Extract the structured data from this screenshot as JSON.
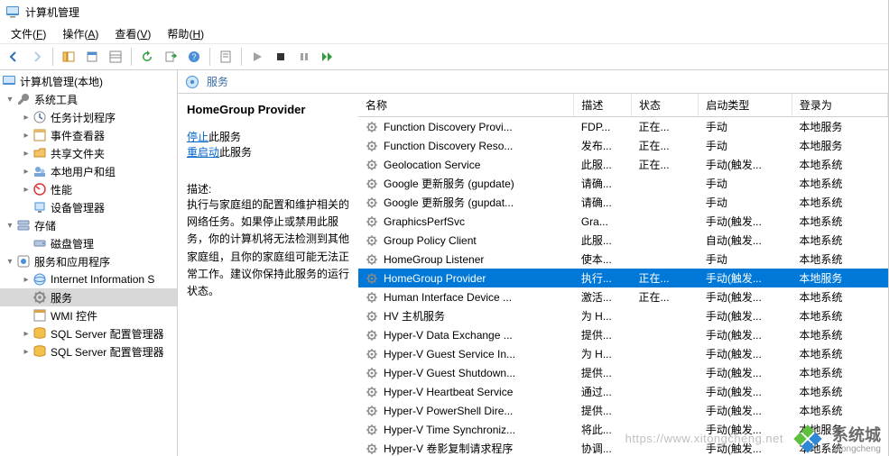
{
  "window": {
    "title": "计算机管理"
  },
  "menubar": [
    {
      "label": "文件",
      "hotkey": "F"
    },
    {
      "label": "操作",
      "hotkey": "A"
    },
    {
      "label": "查看",
      "hotkey": "V"
    },
    {
      "label": "帮助",
      "hotkey": "H"
    }
  ],
  "toolbar": {
    "back": "back-icon",
    "forward": "forward-icon",
    "up": "up-icon",
    "props": "properties-icon",
    "explorer": "explorer-icon",
    "refresh": "refresh-icon",
    "export": "export-icon",
    "help": "help-icon",
    "sheet": "sheet-icon",
    "play": "play-icon",
    "stop": "stop-icon",
    "pause": "pause-icon",
    "restart": "restart-icon"
  },
  "tree": {
    "root": {
      "label": "计算机管理(本地)"
    },
    "system_tools": {
      "label": "系统工具",
      "children": [
        {
          "id": "task-scheduler",
          "label": "任务计划程序"
        },
        {
          "id": "event-viewer",
          "label": "事件查看器"
        },
        {
          "id": "shared-folders",
          "label": "共享文件夹"
        },
        {
          "id": "local-users",
          "label": "本地用户和组"
        },
        {
          "id": "performance",
          "label": "性能"
        },
        {
          "id": "device-manager",
          "label": "设备管理器"
        }
      ]
    },
    "storage": {
      "label": "存储",
      "children": [
        {
          "id": "disk-mgmt",
          "label": "磁盘管理"
        }
      ]
    },
    "services_apps": {
      "label": "服务和应用程序",
      "children": [
        {
          "id": "iis",
          "label": "Internet Information S"
        },
        {
          "id": "services",
          "label": "服务",
          "selected": true
        },
        {
          "id": "wmi",
          "label": "WMI 控件"
        },
        {
          "id": "sqlcfg1",
          "label": "SQL Server 配置管理器"
        },
        {
          "id": "sqlcfg2",
          "label": "SQL Server 配置管理器"
        }
      ]
    }
  },
  "content": {
    "header_label": "服务",
    "selected_name": "HomeGroup Provider",
    "actions": {
      "stop_link": "停止",
      "stop_suffix": "此服务",
      "restart_link": "重启动",
      "restart_suffix": "此服务"
    },
    "desc_label": "描述:",
    "desc_text": "执行与家庭组的配置和维护相关的网络任务。如果停止或禁用此服务，你的计算机将无法检测到其他家庭组，且你的家庭组可能无法正常工作。建议你保持此服务的运行状态。"
  },
  "columns": {
    "name": "名称",
    "desc": "描述",
    "status": "状态",
    "startup": "启动类型",
    "logon": "登录为"
  },
  "services": [
    {
      "name": "Function Discovery Provi...",
      "desc": "FDP...",
      "status": "正在...",
      "startup": "手动",
      "logon": "本地服务"
    },
    {
      "name": "Function Discovery Reso...",
      "desc": "发布...",
      "status": "正在...",
      "startup": "手动",
      "logon": "本地服务"
    },
    {
      "name": "Geolocation Service",
      "desc": "此服...",
      "status": "正在...",
      "startup": "手动(触发...",
      "logon": "本地系统"
    },
    {
      "name": "Google 更新服务 (gupdate)",
      "desc": "请确...",
      "status": "",
      "startup": "手动",
      "logon": "本地系统"
    },
    {
      "name": "Google 更新服务 (gupdat...",
      "desc": "请确...",
      "status": "",
      "startup": "手动",
      "logon": "本地系统"
    },
    {
      "name": "GraphicsPerfSvc",
      "desc": "Gra...",
      "status": "",
      "startup": "手动(触发...",
      "logon": "本地系统"
    },
    {
      "name": "Group Policy Client",
      "desc": "此服...",
      "status": "",
      "startup": "自动(触发...",
      "logon": "本地系统"
    },
    {
      "name": "HomeGroup Listener",
      "desc": "使本...",
      "status": "",
      "startup": "手动",
      "logon": "本地系统"
    },
    {
      "name": "HomeGroup Provider",
      "desc": "执行...",
      "status": "正在...",
      "startup": "手动(触发...",
      "logon": "本地服务",
      "selected": true
    },
    {
      "name": "Human Interface Device ...",
      "desc": "激活...",
      "status": "正在...",
      "startup": "手动(触发...",
      "logon": "本地系统"
    },
    {
      "name": "HV 主机服务",
      "desc": "为 H...",
      "status": "",
      "startup": "手动(触发...",
      "logon": "本地系统"
    },
    {
      "name": "Hyper-V Data Exchange ...",
      "desc": "提供...",
      "status": "",
      "startup": "手动(触发...",
      "logon": "本地系统"
    },
    {
      "name": "Hyper-V Guest Service In...",
      "desc": "为 H...",
      "status": "",
      "startup": "手动(触发...",
      "logon": "本地系统"
    },
    {
      "name": "Hyper-V Guest Shutdown...",
      "desc": "提供...",
      "status": "",
      "startup": "手动(触发...",
      "logon": "本地系统"
    },
    {
      "name": "Hyper-V Heartbeat Service",
      "desc": "通过...",
      "status": "",
      "startup": "手动(触发...",
      "logon": "本地系统"
    },
    {
      "name": "Hyper-V PowerShell Dire...",
      "desc": "提供...",
      "status": "",
      "startup": "手动(触发...",
      "logon": "本地系统"
    },
    {
      "name": "Hyper-V Time Synchroniz...",
      "desc": "将此...",
      "status": "",
      "startup": "手动(触发...",
      "logon": "本地服务"
    },
    {
      "name": "Hyper-V 卷影复制请求程序",
      "desc": "协调...",
      "status": "",
      "startup": "手动(触发...",
      "logon": "本地系统"
    }
  ],
  "watermark": {
    "url": "https://www.xitongcheng.net",
    "brand": "系统城",
    "sub": "xitongcheng"
  }
}
